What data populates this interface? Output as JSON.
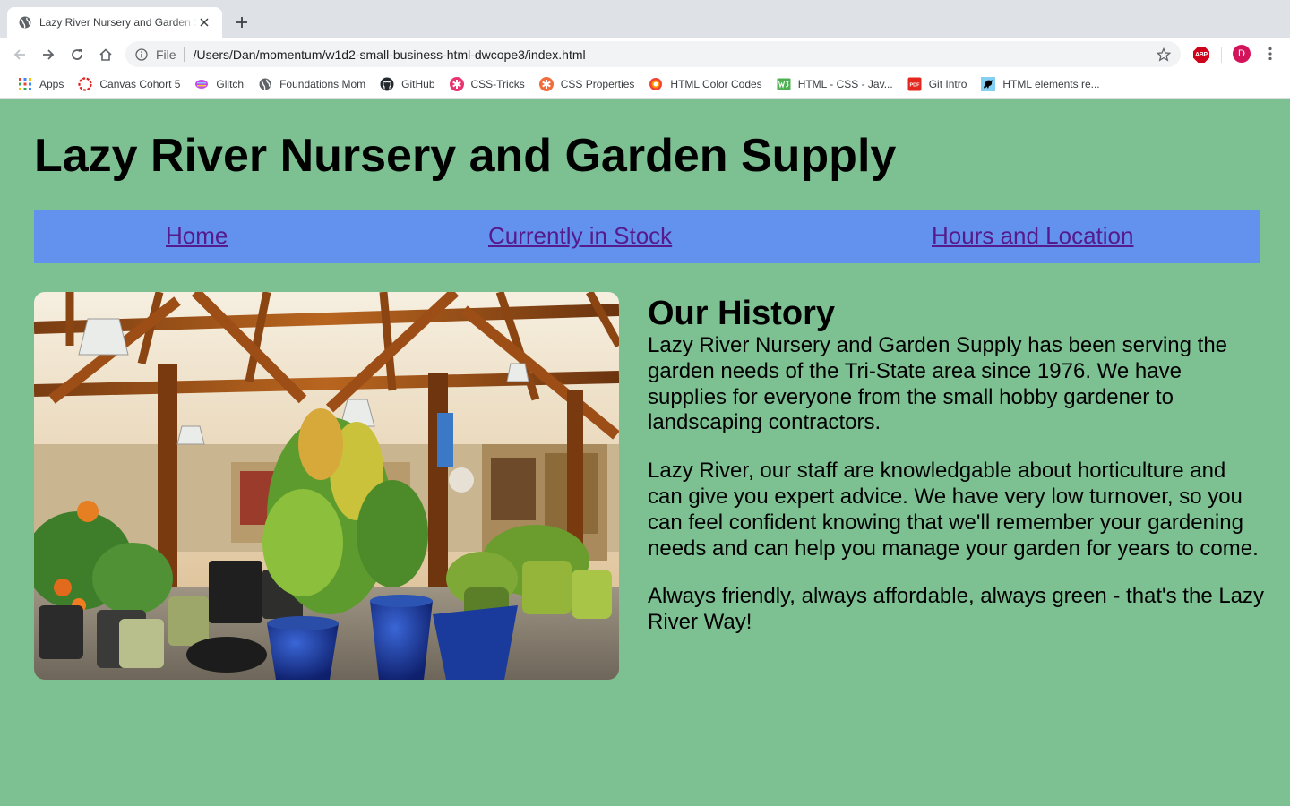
{
  "browser": {
    "tab": {
      "title": "Lazy River Nursery and Garden Supply"
    },
    "address": {
      "scheme_label": "File",
      "url": "/Users/Dan/momentum/w1d2-small-business-html-dwcope3/index.html"
    },
    "profile_initial": "D",
    "adblock_label": "ABP",
    "bookmarks": [
      {
        "label": "Apps",
        "icon": "apps-grid-icon",
        "color": "#4285f4"
      },
      {
        "label": "Canvas Cohort 5",
        "icon": "canvas-icon",
        "color": "#e0201f"
      },
      {
        "label": "Glitch",
        "icon": "glitch-icon",
        "color": "#c44ce6"
      },
      {
        "label": "Foundations Mom",
        "icon": "globe-icon",
        "color": "#5f6368"
      },
      {
        "label": "GitHub",
        "icon": "github-icon",
        "color": "#24292e"
      },
      {
        "label": "CSS-Tricks",
        "icon": "css-tricks-icon",
        "color": "#e8336e"
      },
      {
        "label": "CSS Properties",
        "icon": "css-properties-icon",
        "color": "#f26b3a"
      },
      {
        "label": "HTML Color Codes",
        "icon": "color-codes-icon",
        "color": "#f44336"
      },
      {
        "label": "HTML - CSS - Jav...",
        "icon": "w3-icon",
        "color": "#4caf50"
      },
      {
        "label": "Git Intro",
        "icon": "pdf-icon",
        "color": "#e3271f"
      },
      {
        "label": "HTML elements re...",
        "icon": "mdn-icon",
        "color": "#83d0f2"
      }
    ]
  },
  "page": {
    "title": "Lazy River Nursery and Garden Supply",
    "nav": [
      {
        "label": "Home"
      },
      {
        "label": "Currently in Stock"
      },
      {
        "label": "Hours and Location"
      }
    ],
    "history": {
      "heading": "Our History",
      "paragraphs": [
        "Lazy River Nursery and Garden Supply has been serving the garden needs of the Tri-State area since 1976. We have supplies for everyone from the small hobby gardener to landscaping contractors.",
        "Lazy River, our staff are knowledgable about horticulture and can give you expert advice. We have very low turnover, so you can feel confident knowing that we'll remember your gardening needs and can help you manage your garden for years to come.",
        "Always friendly, always affordable, always green - that's the Lazy River Way!"
      ]
    }
  },
  "colors": {
    "page_background": "#7dc193",
    "nav_background": "#6391ee",
    "link_visited": "#551a8b"
  }
}
